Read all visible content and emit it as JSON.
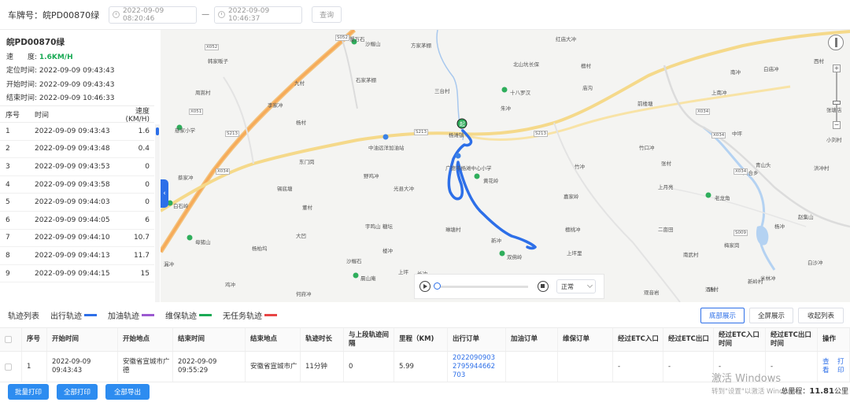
{
  "topbar": {
    "plate_label": "车牌号：",
    "plate_value": "皖PD00870绿",
    "start_time": "2022-09-09 08:20:46",
    "date_separator": "—",
    "end_time": "2022-09-09 10:46:37",
    "query_label": "查询"
  },
  "vehicle": {
    "plate": "皖PD00870绿",
    "speed_label": "速　　度:",
    "speed_value": "1.6KM/H",
    "locate_label": "定位时间:",
    "locate_time": "2022-09-09 09:43:43",
    "start_label": "开始时间:",
    "start_time": "2022-09-09 09:43:43",
    "end_label": "结束时间:",
    "end_time": "2022-09-09 10:46:33"
  },
  "points_table": {
    "headers": [
      "序号",
      "时间",
      "速度(KM/H)"
    ],
    "rows": [
      [
        "1",
        "2022-09-09 09:43:43",
        "1.6"
      ],
      [
        "2",
        "2022-09-09 09:43:48",
        "0.4"
      ],
      [
        "3",
        "2022-09-09 09:43:53",
        "0"
      ],
      [
        "4",
        "2022-09-09 09:43:58",
        "0"
      ],
      [
        "5",
        "2022-09-09 09:44:03",
        "0"
      ],
      [
        "6",
        "2022-09-09 09:44:05",
        "6"
      ],
      [
        "7",
        "2022-09-09 09:44:10",
        "10.7"
      ],
      [
        "8",
        "2022-09-09 09:44:13",
        "11.7"
      ],
      [
        "9",
        "2022-09-09 09:44:15",
        "15"
      ]
    ]
  },
  "map": {
    "labels": [
      "蟹万石",
      "沙幄山",
      "方家茅棚",
      "红庙大冲",
      "西村",
      "韩家畈子",
      "石家茅棚",
      "北山坑",
      "长保",
      "檀村",
      "白庙冲",
      "周嵩村",
      "九村",
      "三台村",
      "十八罗汉",
      "庙沟",
      "南冲",
      "李家冲",
      "朱冲",
      "前楼塘",
      "上南冲",
      "张塘店",
      "杨村",
      "中油远洋加油站",
      "杨滩镇",
      "中坪",
      "小刘村",
      "慈家小学",
      "竹口冲",
      "东门岗",
      "广德市杨滩中心小学",
      "竹冲",
      "张村",
      "青山头",
      "洪冲村",
      "蔡家冲",
      "野鸡冲",
      "黄花岭",
      "上月亮",
      "四合乡",
      "锡底塘",
      "光县大冲",
      "嘉家岭",
      "老龙角",
      "白石岭",
      "董村",
      "赵集山",
      "二亩田",
      "杨冲",
      "大凹",
      "糖坛",
      "檀桃冲",
      "宇鸣山",
      "母猪山",
      "杨柏坞",
      "琳塘村",
      "新冲",
      "上坪里",
      "南武村",
      "梅家岗",
      "白沙冲",
      "漏冲",
      "楼冲",
      "上坪",
      "双佛岭",
      "汤村",
      "米林冲",
      "沙幄石",
      "晨山庵",
      "鸡冲",
      "何府冲",
      "长冲",
      "酒村",
      "观音岩",
      "新岭村"
    ],
    "road_codes": [
      "S052",
      "X052",
      "X051",
      "S213",
      "S213",
      "S213",
      "X034",
      "X034",
      "X034",
      "X034",
      "S009"
    ],
    "player_speed": "正常",
    "progress": 0
  },
  "legend": {
    "title": "轨迹列表",
    "items": [
      {
        "label": "出行轨迹",
        "color": "#2d6fe8"
      },
      {
        "label": "加油轨迹",
        "color": "#9b59d0"
      },
      {
        "label": "维保轨迹",
        "color": "#1aaa55"
      },
      {
        "label": "无任务轨迹",
        "color": "#e84545"
      }
    ]
  },
  "view_buttons": {
    "partial": "底部展示",
    "fullscreen": "全屏展示",
    "collapse": "收起列表"
  },
  "trip_table": {
    "headers": [
      "序号",
      "开始时间",
      "开始地点",
      "结束时间",
      "结束地点",
      "轨迹时长",
      "与上段轨迹间隔",
      "里程（KM)",
      "出行订单",
      "加油订单",
      "维保订单",
      "经过ETC入口",
      "经过ETC出口",
      "经过ETC入口时间",
      "经过ETC出口时间",
      "操作"
    ],
    "rows": [
      {
        "index": "1",
        "start_time": "2022-09-09 09:43:43",
        "start_place": "安徽省宣城市广德",
        "end_time": "2022-09-09 09:55:29",
        "end_place": "安徽省宣城市广",
        "duration": "11分钟",
        "gap": "0",
        "mileage": "5.99",
        "trip_order": "2022090903 2795944662 703",
        "fuel_order": "",
        "maint_order": "",
        "etc_in": "-",
        "etc_out": "-",
        "etc_in_time": "-",
        "etc_out_time": "-",
        "view": "查看",
        "print": "打印"
      }
    ]
  },
  "actions": {
    "batch_print": "批量打印",
    "print_all": "全部打印",
    "export_all": "全部导出"
  },
  "totals": {
    "label": "总里程：",
    "value": "11.81",
    "unit": "公里"
  },
  "watermark": {
    "line1": "激活 Windows",
    "line2": "转到\"设置\"以激活 Windows。"
  }
}
